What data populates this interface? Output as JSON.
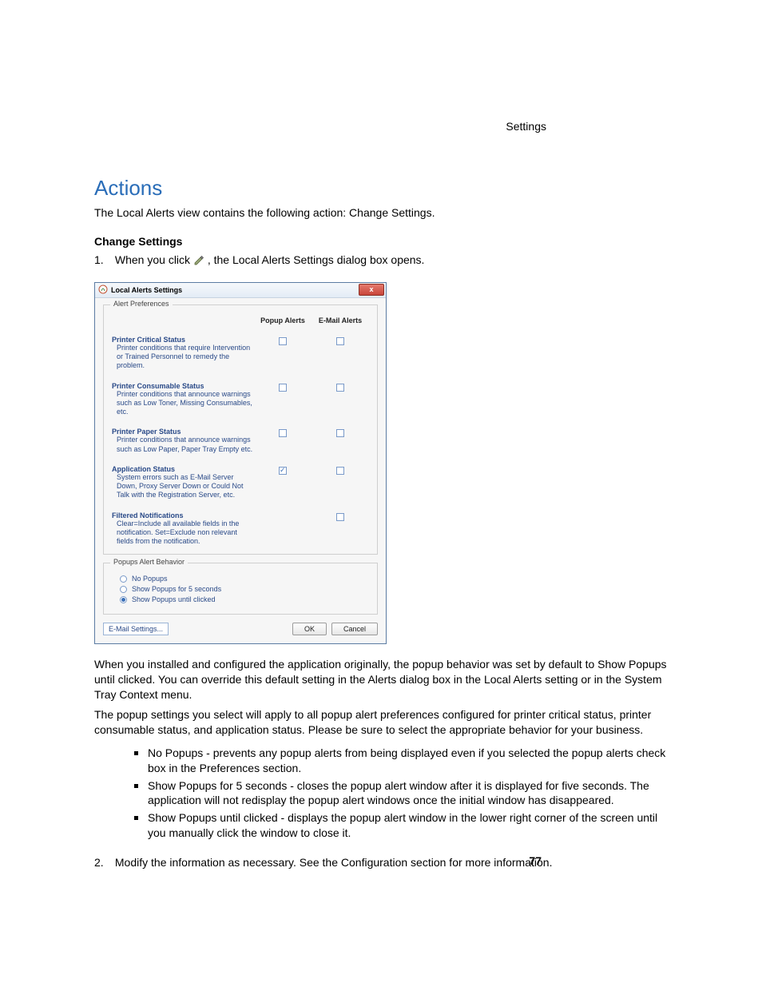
{
  "header_right": "Settings",
  "section_title": "Actions",
  "intro": "The Local Alerts view contains the following action: Change Settings.",
  "change_settings_heading": "Change Settings",
  "step1_prefix": "When you click",
  "step1_suffix": ", the Local Alerts Settings dialog box opens.",
  "step1_num": "1.",
  "para_installed": "When you installed and configured the application originally, the popup behavior was set by default to Show Popups until clicked. You can override this default setting in the Alerts dialog box in the Local Alerts setting or in the System Tray Context menu.",
  "para_popup": "The popup settings you select will apply to all popup alert preferences configured for printer critical status, printer consumable status, and application status. Please be sure to select the appropriate behavior for your business.",
  "bullets": [
    "No Popups - prevents any popup alerts from being displayed even if you selected the popup alerts check box in the Preferences section.",
    "Show Popups for 5 seconds - closes the popup alert window after it is displayed for five seconds. The application will not redisplay the popup alert windows once the initial window has disappeared.",
    "Show Popups until clicked - displays the popup alert window in the lower right corner of the screen until you manually click the window to close it."
  ],
  "step2_num": "2.",
  "step2_text": "Modify the information as necessary. See the Configuration section for more information.",
  "page_number": "77",
  "dialog": {
    "title": "Local Alerts Settings",
    "close_glyph": "x",
    "prefs_legend": "Alert Preferences",
    "col_popup": "Popup Alerts",
    "col_email": "E-Mail Alerts",
    "rows": [
      {
        "title": "Printer Critical Status",
        "desc": "Printer conditions that require Intervention or Trained Personnel to remedy the problem.",
        "popup": false,
        "email": false,
        "hide_popup": false
      },
      {
        "title": "Printer Consumable Status",
        "desc": "Printer conditions that announce warnings such as Low Toner, Missing Consumables, etc.",
        "popup": false,
        "email": false,
        "hide_popup": false
      },
      {
        "title": "Printer Paper Status",
        "desc": "Printer conditions that announce warnings such as Low Paper, Paper Tray Empty etc.",
        "popup": false,
        "email": false,
        "hide_popup": false
      },
      {
        "title": "Application Status",
        "desc": "System errors such as E-Mail Server Down, Proxy Server Down or Could Not Talk with the Registration Server, etc.",
        "popup": true,
        "email": false,
        "hide_popup": false
      },
      {
        "title": "Filtered Notifications",
        "desc": "Clear=Include all available fields in the notification. Set=Exclude non relevant fields from the notification.",
        "popup": false,
        "email": false,
        "hide_popup": true
      }
    ],
    "behavior_legend": "Popups Alert Behavior",
    "radios": [
      {
        "label": "No Popups",
        "selected": false
      },
      {
        "label": "Show Popups for 5 seconds",
        "selected": false
      },
      {
        "label": "Show Popups until clicked",
        "selected": true
      }
    ],
    "email_settings": "E-Mail Settings...",
    "ok": "OK",
    "cancel": "Cancel"
  }
}
